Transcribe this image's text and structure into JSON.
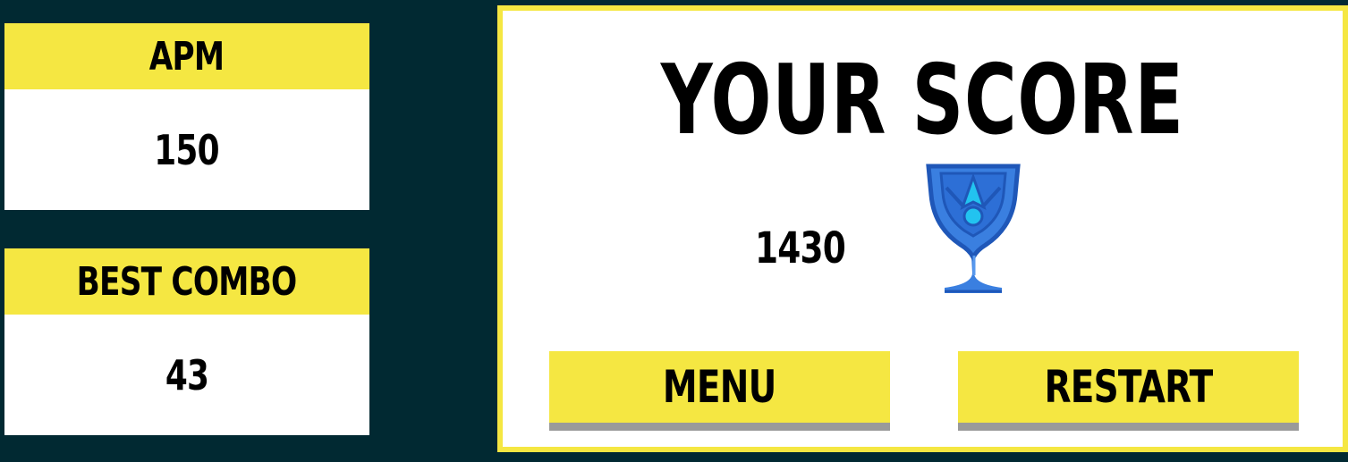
{
  "stats": {
    "apm": {
      "label": "APM",
      "value": "150"
    },
    "best_combo": {
      "label": "BEST COMBO",
      "value": "43"
    }
  },
  "score_panel": {
    "title": "YOUR SCORE",
    "score": "1430",
    "trophy_icon": "trophy-icon",
    "menu_label": "MENU",
    "restart_label": "RESTART"
  },
  "colors": {
    "background": "#012932",
    "accent_yellow": "#f5e742",
    "panel": "#ffffff",
    "button_shadow": "#9a9a9a",
    "trophy_blue": "#3a7fe0",
    "trophy_dark": "#1f57b8",
    "trophy_light": "#22c3f0"
  }
}
